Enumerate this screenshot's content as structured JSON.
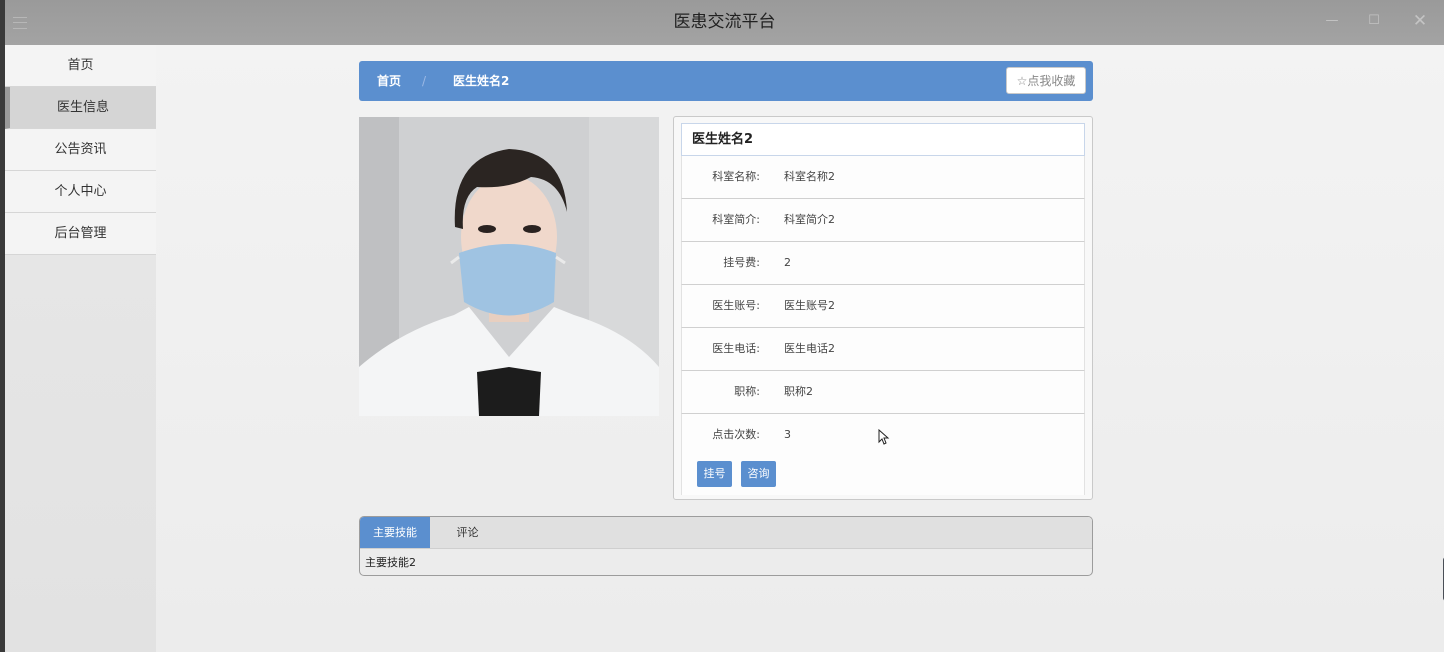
{
  "window": {
    "title": "医患交流平台",
    "controls": {
      "minimize": "—",
      "maximize": "☐",
      "close": "✕"
    }
  },
  "sidebar": {
    "items": [
      {
        "label": "首页",
        "active": false
      },
      {
        "label": "医生信息",
        "active": true
      },
      {
        "label": "公告资讯",
        "active": false
      },
      {
        "label": "个人中心",
        "active": false
      },
      {
        "label": "后台管理",
        "active": false
      }
    ]
  },
  "breadcrumb": {
    "home": "首页",
    "separator": "/",
    "current": "医生姓名2",
    "favorite_button": "☆点我收藏"
  },
  "doctor": {
    "name": "医生姓名2",
    "fields": [
      {
        "label": "科室名称:",
        "value": "科室名称2"
      },
      {
        "label": "科室简介:",
        "value": "科室简介2"
      },
      {
        "label": "挂号费:",
        "value": "2"
      },
      {
        "label": "医生账号:",
        "value": "医生账号2"
      },
      {
        "label": "医生电话:",
        "value": "医生电话2"
      },
      {
        "label": "职称:",
        "value": "职称2"
      },
      {
        "label": "点击次数:",
        "value": "3"
      }
    ],
    "actions": {
      "register": "挂号",
      "consult": "咨询"
    }
  },
  "tabs": {
    "items": [
      "主要技能",
      "评论"
    ],
    "active": "主要技能",
    "content": "主要技能2"
  },
  "colors": {
    "accent": "#5b8fcf",
    "titlebar": "#9e9e9e"
  }
}
